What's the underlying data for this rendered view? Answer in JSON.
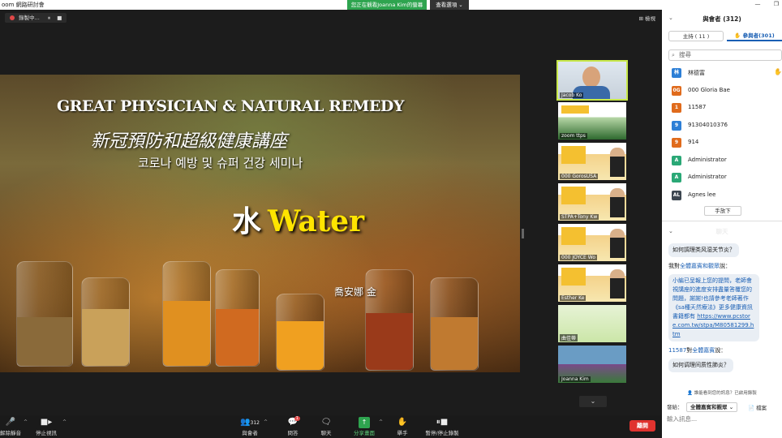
{
  "window": {
    "title": "oom 網路研討會"
  },
  "share_banner": "您正在觀看Joanna Kim的螢幕",
  "view_options": "查看選項 ⌄",
  "recording": {
    "label": "錄製中...",
    "pause": "⏸",
    "stop": "■"
  },
  "gallery_label": "⊞ 檢視",
  "slide": {
    "title_en": "GREAT PHYSICIAN & NATURAL REMEDY",
    "title_zh": "新冠預防和超級健康講座",
    "title_ko": "코로나 예방 및 슈퍼 건강 세미나",
    "water_zh": "水",
    "water_en": "Water",
    "author": "喬安娜 金"
  },
  "thumbnails": [
    {
      "name": "Jacob Ko",
      "style": "person",
      "active": true
    },
    {
      "name": "zoom ttps",
      "style": "ppt"
    },
    {
      "name": "000 GorosUSA",
      "style": "slide"
    },
    {
      "name": "STPA+Tony Kw",
      "style": "slide"
    },
    {
      "name": "000 JOYCE Wo",
      "style": "slide"
    },
    {
      "name": "Esther Ke",
      "style": "slide"
    },
    {
      "name": "曲佳蒂",
      "style": "green"
    },
    {
      "name": "Joanna Kim",
      "style": "tulip"
    }
  ],
  "toolbar": {
    "mute": "解除靜音",
    "stop_video": "停止視訊",
    "participants": "與會者",
    "participants_count": "312",
    "qa": "問答",
    "qa_badge": "1",
    "chat": "聊天",
    "share": "分享畫面",
    "raise_hand": "舉手",
    "pause_rec": "暫停/停止錄製",
    "end": "離開"
  },
  "panel": {
    "participants_title": "與會者 (312)",
    "tab_panelists": "主持 ( 11 )",
    "tab_attendees": "參與者(301)",
    "search_placeholder": "搜尋",
    "participants": [
      {
        "initials": "林",
        "name": "林德富",
        "color": "#2d7fd6",
        "hand": true
      },
      {
        "initials": "0G",
        "name": "000 Gloria Bae",
        "color": "#e06b1c"
      },
      {
        "initials": "1",
        "name": "11587",
        "color": "#e06b1c"
      },
      {
        "initials": "9",
        "name": "91304010376",
        "color": "#2d7fd6"
      },
      {
        "initials": "9",
        "name": "914",
        "color": "#e06b1c"
      },
      {
        "initials": "A",
        "name": "Administrator",
        "color": "#2aa876"
      },
      {
        "initials": "A",
        "name": "Administrator",
        "color": "#2aa876"
      },
      {
        "initials": "AL",
        "name": "Agnes lee",
        "color": "#3c4650"
      }
    ],
    "lower_hand": "手放下",
    "chat_title": "聊天",
    "chat": {
      "msg1": "如何調理类风湿关节炎？",
      "from1_prefix": "我對",
      "from1_to": "全體嘉賓和觀眾",
      "from1_suffix": "說：",
      "msg2": "小編已呈報上您的提問，老師會視講座的進度安排盡量答覆您的問題，謝謝!也請參考老師著作《sa種天然療法》更多健康資訊書籍都有",
      "msg2_link": "https://www.pcstore.com.tw/stpa/M80581299.htm",
      "from2_sender": "11587",
      "from2_mid": "對",
      "from2_to": "全體嘉賓",
      "from2_suffix": "說：",
      "msg3": "如何调理间质性肺炎？"
    },
    "viewer_note": "誰能看到您的訊息？已啟用錄製",
    "send_to_label": "發給：",
    "send_to_value": "全體嘉賓和觀眾 ⌄",
    "file_label": "📄 檔案",
    "input_placeholder": "輸入訊息..."
  }
}
